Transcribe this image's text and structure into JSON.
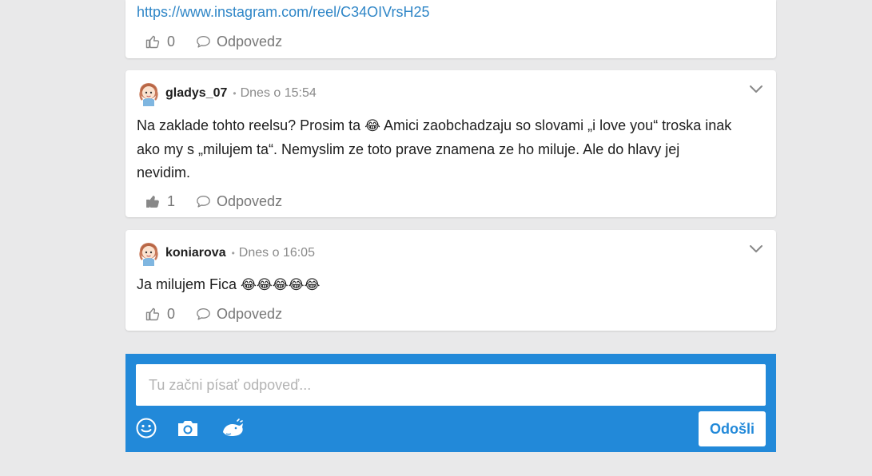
{
  "posts": [
    {
      "link": "https://www.instagram.com/reel/C34OIVrsH25",
      "likes": "0",
      "reply_label": "Odpovedz"
    },
    {
      "username": "gladys_07",
      "separator": "•",
      "time": "Dnes o 15:54",
      "text_line1_a": "Na zaklade tohto reelsu? Prosim ta ",
      "emoji": "😂",
      "text_line1_b": " Amici zaobchadzaju so slovami „i love you“ troska inak",
      "text_line2": "ako my s „milujem ta“. Nemyslim ze toto prave znamena ze ho miluje. Ale do hlavy jej",
      "text_line3": "nevidim.",
      "likes": "1",
      "reply_label": "Odpovedz"
    },
    {
      "username": "koniarova",
      "separator": "•",
      "time": "Dnes o 16:05",
      "text": "Ja milujem Fica ",
      "emojis": "😂😂😂😂😂",
      "likes": "0",
      "reply_label": "Odpovedz"
    }
  ],
  "composer": {
    "placeholder": "Tu začni písať odpoveď...",
    "send_label": "Odošli",
    "tools": [
      "smiley-icon",
      "camera-icon",
      "sticker-icon"
    ]
  },
  "colors": {
    "accent": "#2289d9",
    "link": "#2f86c7",
    "background": "#e9e9ea"
  }
}
